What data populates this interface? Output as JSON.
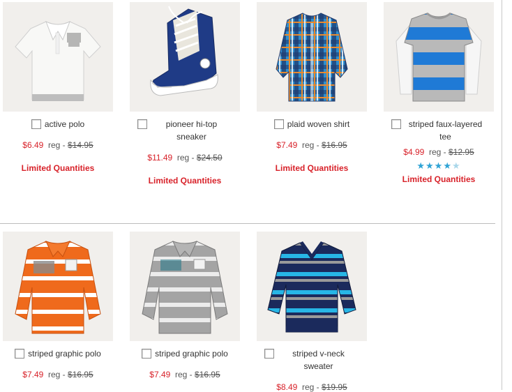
{
  "products": [
    {
      "name": "active polo",
      "sale": "$6.49",
      "reg_label": "reg -",
      "reg": "$14.95",
      "limited": "Limited Quantities"
    },
    {
      "name": "pioneer hi-top sneaker",
      "sale": "$11.49",
      "reg_label": "reg -",
      "reg": "$24.50",
      "limited": "Limited Quantities"
    },
    {
      "name": "plaid woven shirt",
      "sale": "$7.49",
      "reg_label": "reg -",
      "reg": "$16.95",
      "limited": "Limited Quantities"
    },
    {
      "name": "striped faux-layered tee",
      "sale": "$4.99",
      "reg_label": "reg -",
      "reg": "$12.95",
      "rating": 4.5,
      "rating_stars": "★★★★",
      "rating_half": "★",
      "limited": "Limited Quantities"
    },
    {
      "name": "striped graphic polo",
      "sale": "$7.49",
      "reg_label": "reg -",
      "reg": "$16.95"
    },
    {
      "name": "striped graphic polo",
      "sale": "$7.49",
      "reg_label": "reg -",
      "reg": "$16.95"
    },
    {
      "name": "striped v-neck sweater",
      "sale": "$8.49",
      "reg_label": "reg -",
      "reg": "$19.95"
    }
  ],
  "colors": {
    "sale": "#d8222a",
    "accent_star": "#2ea3d5",
    "thumb_bg": "#f1efec"
  }
}
